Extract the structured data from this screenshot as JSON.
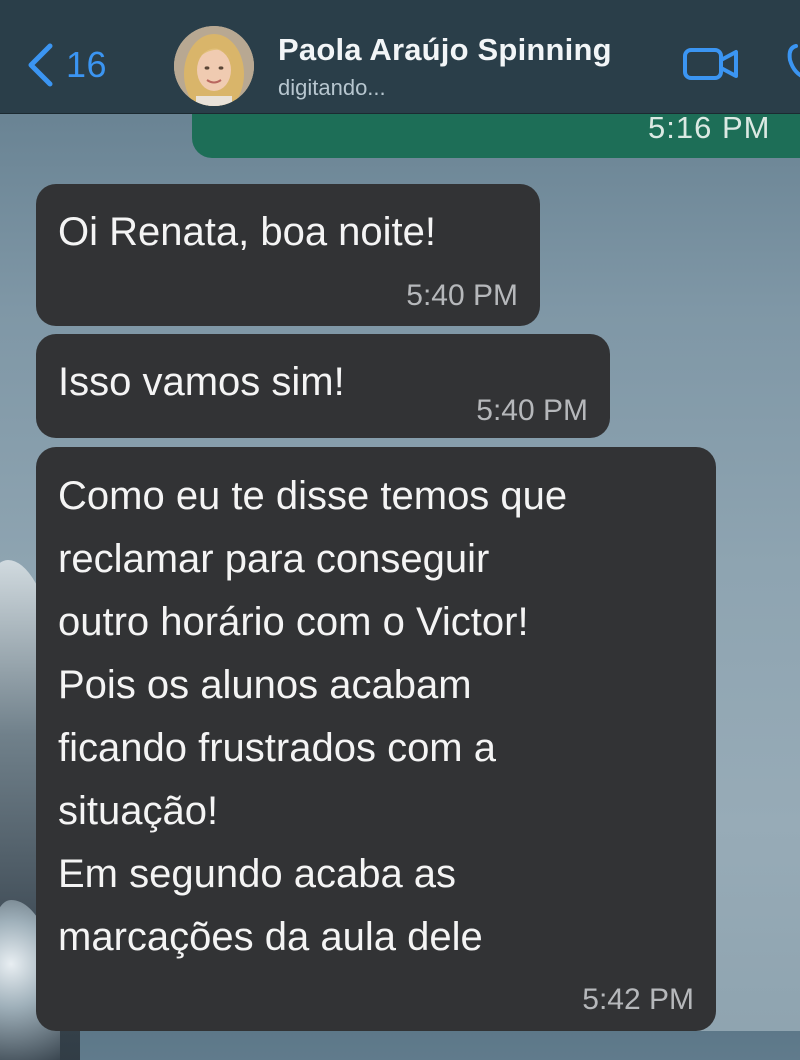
{
  "header": {
    "back_count": "16",
    "contact_name": "Paola Araújo Spinning",
    "status": "digitando...",
    "icons": {
      "back": "chevron-left-icon",
      "video": "video-camera-icon",
      "phone": "phone-icon"
    }
  },
  "messages": {
    "outgoing_top_time": "5:16 PM",
    "incoming": [
      {
        "text": "Oi Renata, boa noite!",
        "time": "5:40 PM"
      },
      {
        "text": "Isso vamos sim!",
        "time": "5:40 PM"
      },
      {
        "text": "Como eu te disse temos que\nreclamar para conseguir\noutro horário com o Victor!\nPois os alunos acabam\nficando frustrados com a\nsituação!\nEm segundo acaba as\nmarcações da aula dele",
        "time": "5:42 PM"
      }
    ]
  },
  "colors": {
    "header_bg": "#2a3e49",
    "accent": "#3b95f2",
    "incoming_bubble": "#323335",
    "outgoing_bubble": "#1d6e57"
  }
}
